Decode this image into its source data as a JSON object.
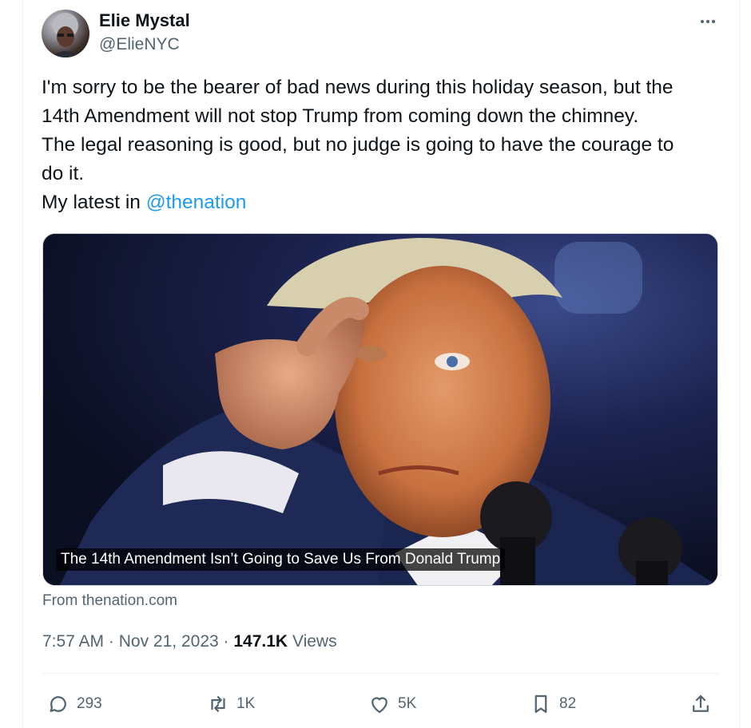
{
  "author": {
    "name": "Elie Mystal",
    "handle": "@ElieNYC"
  },
  "tweet": {
    "lines": [
      "I'm sorry to be the bearer of bad news during this holiday season, but the",
      "14th Amendment will not stop Trump from coming down the chimney.",
      "The legal reasoning is good, but no judge is going to have the courage to",
      "do it."
    ],
    "latest_prefix": "My latest in",
    "mention": "@thenation"
  },
  "card": {
    "headline": "The 14th Amendment Isn’t Going to Save Us From Donald Trump",
    "source": "From thenation.com"
  },
  "meta": {
    "time": "7:57 AM",
    "separator": "·",
    "date": "Nov 21, 2023",
    "views_count": "147.1K",
    "views_label": "Views"
  },
  "actions": {
    "replies": "293",
    "reposts": "1K",
    "likes": "5K",
    "bookmarks": "82"
  },
  "colors": {
    "link": "#1d9bf0",
    "secondary_text": "#536471",
    "primary_text": "#0f1419"
  },
  "icons": [
    "more-icon",
    "reply-icon",
    "repost-icon",
    "like-icon",
    "bookmark-icon",
    "share-icon"
  ]
}
